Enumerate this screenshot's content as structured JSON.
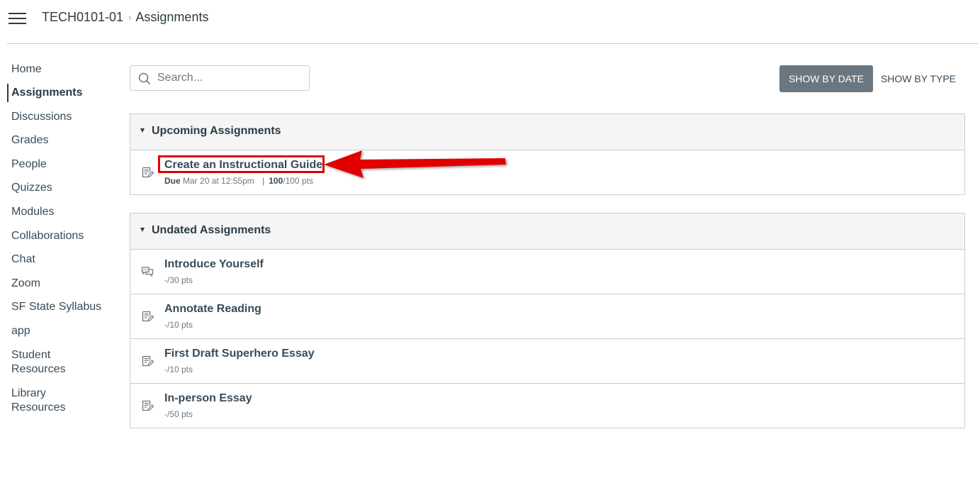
{
  "breadcrumb": {
    "course": "TECH0101-01",
    "separator": "›",
    "current": "Assignments"
  },
  "sidebar": {
    "items": [
      {
        "label": "Home"
      },
      {
        "label": "Assignments",
        "active": true
      },
      {
        "label": "Discussions"
      },
      {
        "label": "Grades"
      },
      {
        "label": "People"
      },
      {
        "label": "Quizzes"
      },
      {
        "label": "Modules"
      },
      {
        "label": "Collaborations"
      },
      {
        "label": "Chat"
      },
      {
        "label": "Zoom"
      },
      {
        "label": "SF State Syllabus"
      },
      {
        "label": "app"
      },
      {
        "label": "Student Resources",
        "lines": [
          "Student",
          "Resources"
        ]
      },
      {
        "label": "Library Resources",
        "lines": [
          "Library",
          "Resources"
        ]
      }
    ]
  },
  "search": {
    "placeholder": "Search...",
    "icon": "search-icon"
  },
  "view_toggle": {
    "by_date": "SHOW BY DATE",
    "by_type": "SHOW BY TYPE"
  },
  "groups": {
    "upcoming": {
      "title": "Upcoming Assignments",
      "items": [
        {
          "title": "Create an Instructional Guide",
          "icon": "assignment-icon",
          "due_label": "Due",
          "due_date": "Mar 20 at 12:55pm",
          "meta_sep": "|",
          "points_earned": "100",
          "points_total": "/100 pts"
        }
      ]
    },
    "undated": {
      "title": "Undated Assignments",
      "items": [
        {
          "title": "Introduce Yourself",
          "icon": "discussion-icon",
          "points": "-/30 pts"
        },
        {
          "title": "Annotate Reading",
          "icon": "assignment-icon",
          "points": "-/10 pts"
        },
        {
          "title": "First Draft Superhero Essay",
          "icon": "assignment-icon",
          "points": "-/10 pts"
        },
        {
          "title": "In-person Essay",
          "icon": "assignment-icon",
          "points": "-/50 pts"
        }
      ]
    }
  },
  "annotation": {
    "color": "#e00000"
  },
  "colors": {
    "primary_button": "#6b7780",
    "text": "#2d3b45",
    "border": "#c7cdd1",
    "header_bg": "#f5f5f5"
  }
}
